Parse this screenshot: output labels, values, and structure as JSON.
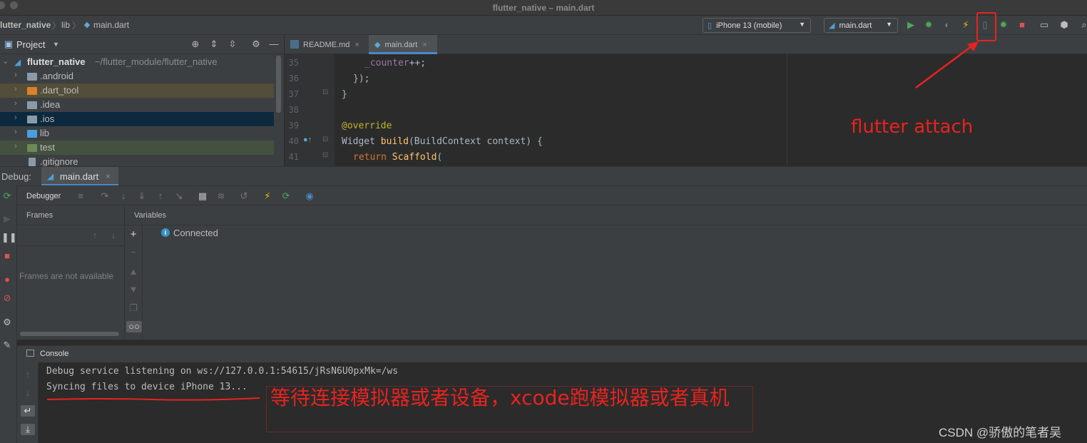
{
  "window": {
    "title": "flutter_native – main.dart"
  },
  "navbar": {
    "crumbs": [
      "lutter_native",
      "lib",
      "main.dart"
    ],
    "device": "iPhone 13 (mobile)",
    "config": "main.dart"
  },
  "project": {
    "header": "Project",
    "root_name": "flutter_native",
    "root_path": "~/flutter_module/flutter_native",
    "items": [
      {
        "label": ".android"
      },
      {
        "label": ".dart_tool"
      },
      {
        "label": ".idea"
      },
      {
        "label": ".ios"
      },
      {
        "label": "lib"
      },
      {
        "label": "test"
      },
      {
        "label": ".gitignore"
      }
    ]
  },
  "editor": {
    "tabs": [
      {
        "label": "README.md"
      },
      {
        "label": "main.dart"
      }
    ],
    "line_numbers": [
      "35",
      "36",
      "37",
      "38",
      "39",
      "40",
      "41"
    ],
    "lines": {
      "l35": "_counter",
      "l35b": "++;",
      "l36": "});",
      "l37": "}",
      "l39": "@override",
      "l40a": "Widget ",
      "l40b": "build",
      "l40c": "(BuildContext context) {",
      "l41a": "return ",
      "l41b": "Scaffold",
      "l41c": "("
    }
  },
  "debug": {
    "label": "Debug:",
    "tab": "main.dart",
    "debugger_tab": "Debugger",
    "frames_header": "Frames",
    "frames_empty": "Frames are not available",
    "variables_header": "Variables",
    "status": "Connected",
    "console_header": "Console",
    "console_lines": [
      "Debug service listening on ws://127.0.0.1:54615/jRsN6U0pxMk=/ws",
      "Syncing files to device iPhone 13..."
    ]
  },
  "annotations": {
    "attach_label": "flutter attach",
    "wait_note": "等待连接模拟器或者设备，xcode跑模拟器或者真机",
    "watermark": "CSDN @骄傲的笔者吴"
  },
  "colors": {
    "annotation_red": "#e8231f",
    "ide_panel": "#3c3f41",
    "editor_bg": "#2b2b2b",
    "selection_blue": "#0d293e"
  },
  "icons": [
    "close-icon",
    "play-icon",
    "debug-bug-icon",
    "lightning-icon",
    "attach-device-icon",
    "stop-icon",
    "settings-gear-icon",
    "info-icon",
    "flutter-icon"
  ]
}
